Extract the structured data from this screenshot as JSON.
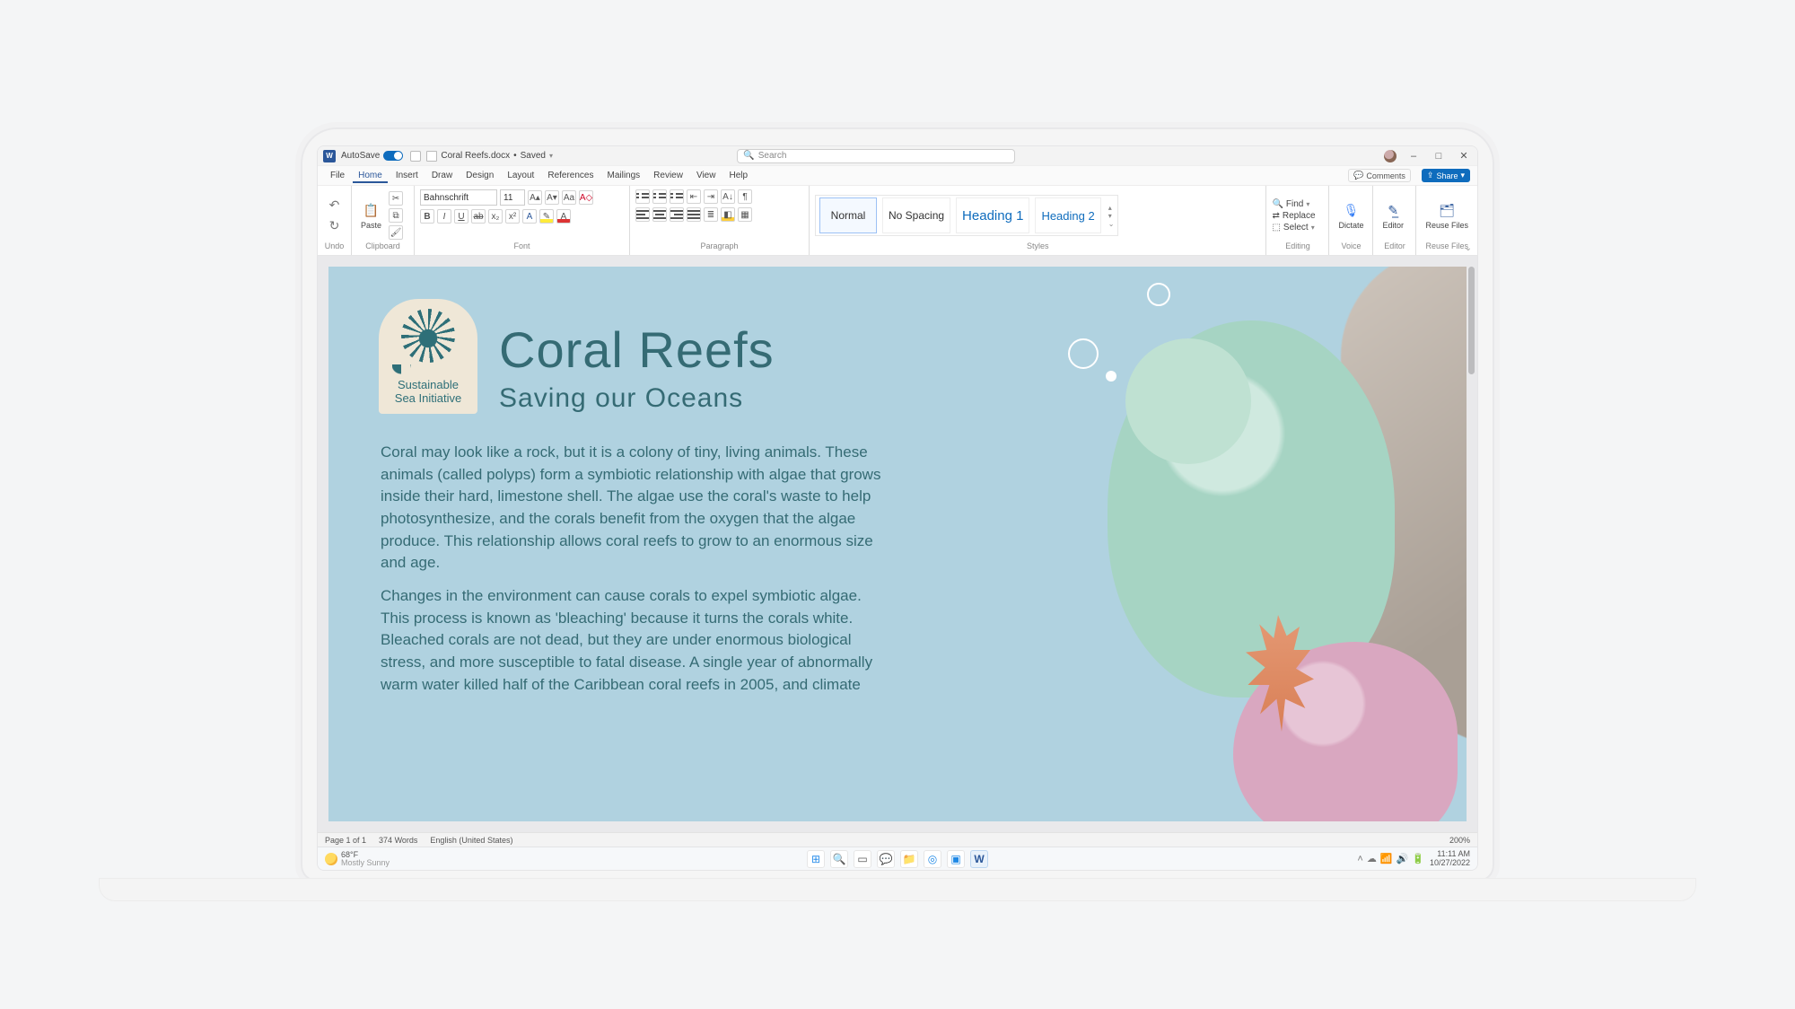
{
  "titlebar": {
    "autosave_label": "AutoSave",
    "autosave_state": "On",
    "docname": "Coral Reefs.docx",
    "saved": "Saved",
    "search_placeholder": "Search",
    "minimize": "–",
    "maximize": "□",
    "close": "✕"
  },
  "menu": {
    "items": [
      "File",
      "Home",
      "Insert",
      "Draw",
      "Design",
      "Layout",
      "References",
      "Mailings",
      "Review",
      "View",
      "Help"
    ],
    "active": "Home",
    "comments": "Comments",
    "share": "Share"
  },
  "ribbon": {
    "undo": {
      "label": "Undo"
    },
    "clipboard": {
      "label": "Clipboard",
      "paste": "Paste"
    },
    "font": {
      "label": "Font",
      "family": "Bahnschrift",
      "size": "11",
      "bold": "B",
      "italic": "I",
      "underline": "U",
      "strike": "ab",
      "sub": "x₂",
      "sup": "x²"
    },
    "paragraph": {
      "label": "Paragraph"
    },
    "styles": {
      "label": "Styles",
      "items": [
        {
          "name": "Normal",
          "cls": "sel"
        },
        {
          "name": "No Spacing",
          "cls": ""
        },
        {
          "name": "Heading 1",
          "cls": "h1"
        },
        {
          "name": "Heading 2",
          "cls": "h2"
        }
      ]
    },
    "editing": {
      "label": "Editing",
      "find": "Find",
      "replace": "Replace",
      "select": "Select"
    },
    "voice": {
      "label": "Voice",
      "btn": "Dictate"
    },
    "editor": {
      "label": "Editor",
      "btn": "Editor"
    },
    "reuse": {
      "label": "Reuse Files",
      "btn": "Reuse Files"
    }
  },
  "document": {
    "logo_line1": "Sustainable",
    "logo_line2": "Sea Initiative",
    "title": "Coral Reefs",
    "subtitle": "Saving our Oceans",
    "para1": "Coral may look like a rock, but it is a colony of tiny, living animals. These animals (called polyps) form a symbiotic relationship with algae that grows inside their hard, limestone shell. The algae use the coral's waste to help photosynthesize, and the corals benefit from the oxygen that the algae produce. This relationship allows coral reefs to grow to an enormous size and age.",
    "para2": "Changes in the environment can cause corals to expel symbiotic algae. This process is known as 'bleaching' because it turns the corals white. Bleached corals are not dead, but they are under enormous biological stress, and more susceptible to fatal disease. A single year of abnormally warm water killed half of the Caribbean coral reefs in 2005, and climate"
  },
  "status": {
    "page": "Page 1 of 1",
    "words": "374 Words",
    "lang": "English (United States)",
    "zoom": "200%"
  },
  "taskbar": {
    "temp": "68°F",
    "cond": "Mostly Sunny",
    "time": "11:11 AM",
    "date": "10/27/2022"
  }
}
